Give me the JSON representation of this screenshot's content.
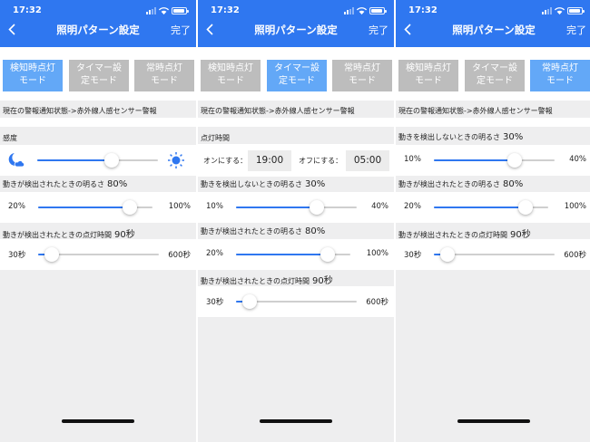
{
  "status": {
    "time": "17:32"
  },
  "header": {
    "title": "照明パターン設定",
    "done_label": "完了"
  },
  "modes": [
    {
      "line1": "検知時点灯",
      "line2": "モード"
    },
    {
      "line1": "タイマー設",
      "line2": "定モード"
    },
    {
      "line1": "常時点灯",
      "line2": "モード"
    }
  ],
  "colors": {
    "accent": "#2f77f0",
    "mode_active": "#63a8f7",
    "mode_inactive": "#bdbdbd",
    "slider_track": "#cfcfcf"
  },
  "panels": [
    {
      "active_mode": 0,
      "alert_status": "現在の警報通知状態->赤外線人感センサー警報",
      "sensitivity": {
        "label": "感度",
        "level": 0.62
      },
      "detected_brightness": {
        "label": "動きが検出されたときの明るさ",
        "value": "80%",
        "min": "20%",
        "max": "100%",
        "level": 0.8
      },
      "on_duration": {
        "label": "動きが検出されたときの点灯時間",
        "value": "90秒",
        "min": "30秒",
        "max": "600秒",
        "level": 0.11
      }
    },
    {
      "active_mode": 1,
      "alert_status": "現在の警報通知状態->赤外線人感センサー警報",
      "lighting_time": {
        "label": "点灯時間",
        "on_label": "オンにする：",
        "on_value": "19:00",
        "off_label": "オフにする：",
        "off_value": "05:00"
      },
      "idle_brightness": {
        "label": "動きを検出しないときの明るさ",
        "value": "30%",
        "min": "10%",
        "max": "40%",
        "level": 0.67
      },
      "detected_brightness": {
        "label": "動きが検出されたときの明るさ",
        "value": "80%",
        "min": "20%",
        "max": "100%",
        "level": 0.8
      },
      "on_duration": {
        "label": "動きが検出されたときの点灯時間",
        "value": "90秒",
        "min": "30秒",
        "max": "600秒",
        "level": 0.11
      }
    },
    {
      "active_mode": 2,
      "alert_status": "現在の警報通知状態->赤外線人感センサー警報",
      "idle_brightness": {
        "label": "動きを検出しないときの明るさ",
        "value": "30%",
        "min": "10%",
        "max": "40%",
        "level": 0.67
      },
      "detected_brightness": {
        "label": "動きが検出されたときの明るさ",
        "value": "80%",
        "min": "20%",
        "max": "100%",
        "level": 0.8
      },
      "on_duration": {
        "label": "動きが検出されたときの点灯時間",
        "value": "90秒",
        "min": "30秒",
        "max": "600秒",
        "level": 0.11
      }
    }
  ]
}
